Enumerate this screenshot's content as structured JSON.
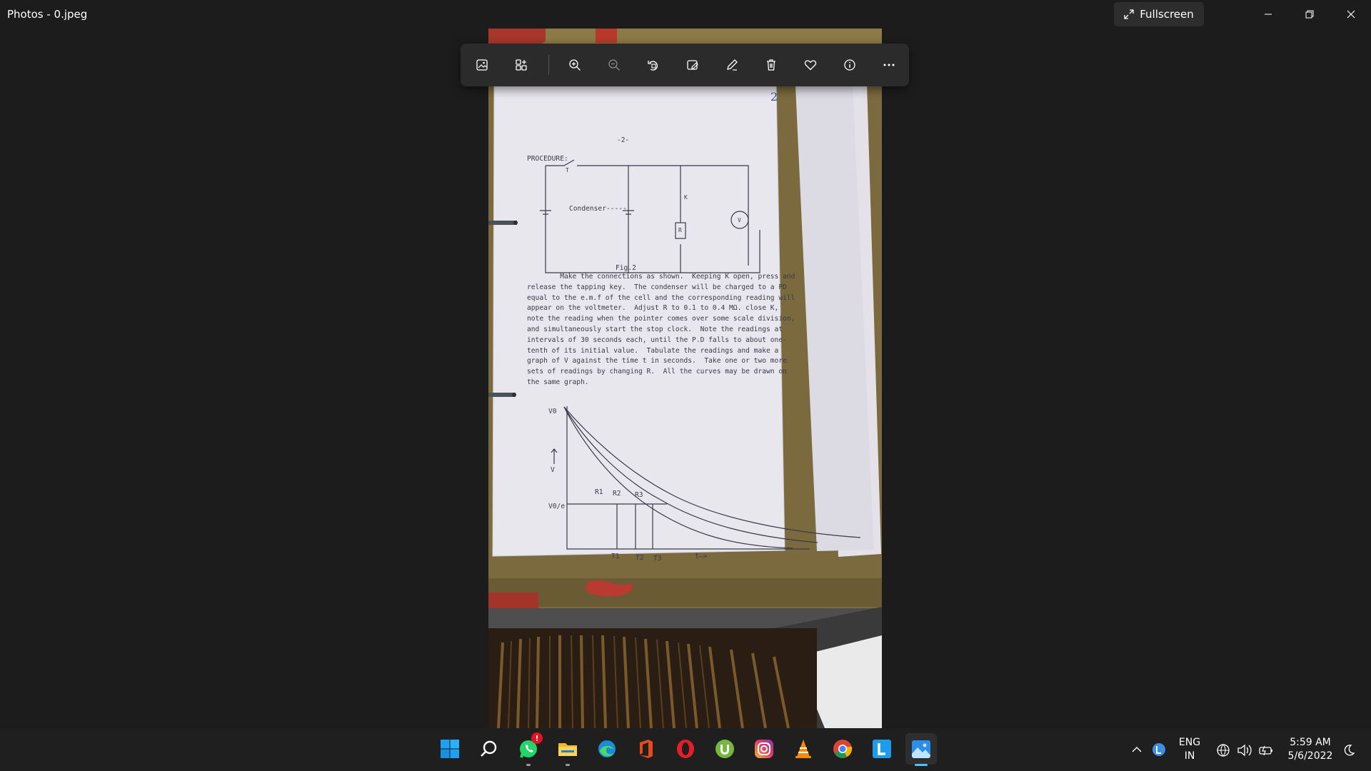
{
  "window": {
    "title": "Photos - 0.jpeg",
    "fullscreen_label": "Fullscreen",
    "minimize_icon": "minimize-icon",
    "restore_icon": "restore-icon",
    "close_icon": "close-icon"
  },
  "toolbar": {
    "buttons": [
      {
        "name": "view-actual-size-icon"
      },
      {
        "name": "gallery-icon"
      },
      {
        "name": "zoom-in-icon"
      },
      {
        "name": "zoom-out-icon"
      },
      {
        "name": "rotate-icon"
      },
      {
        "name": "edit-image-icon"
      },
      {
        "name": "draw-icon"
      },
      {
        "name": "delete-icon"
      },
      {
        "name": "favorite-icon"
      },
      {
        "name": "info-icon"
      },
      {
        "name": "more-icon"
      }
    ]
  },
  "photo": {
    "page_number_mark": "2",
    "page_top_mark": "-2-",
    "heading": "PROCEDURE:",
    "fig_caption": "Fig.2",
    "condenser_label": "Condenser-----",
    "circuit_labels": {
      "switch": "T",
      "key": "K",
      "resistor": "R",
      "voltmeter": "V"
    },
    "procedure_lines": [
      "        Make the connections as shown.  Keeping K open, press and",
      "release the tapping key.  The condenser will be charged to a PD",
      "equal to the e.m.f of the cell and the corresponding reading will",
      "appear on the voltmeter.  Adjust R to 0.1 to 0.4 MΩ. close K,",
      "note the reading when the pointer comes over some scale division,",
      "and simultaneously start the stop clock.  Note the readings at",
      "intervals of 30 seconds each, until the P.D falls to about one-",
      "tenth of its initial value.  Tabulate the readings and make a",
      "graph of V against the time t in seconds.  Take one or two more",
      "sets of readings by changing R.  All the curves may be drawn on",
      "the same graph."
    ],
    "graph_labels": {
      "v0": "V0",
      "v_axis": "V",
      "v0e": "V0/e",
      "r1": "R1",
      "r2": "R2",
      "r3": "R3",
      "t1": "T1",
      "t2": "T2",
      "t3": "T3",
      "t_axis": "t—>"
    }
  },
  "taskbar": {
    "apps": [
      {
        "name": "start-icon"
      },
      {
        "name": "search-icon"
      },
      {
        "name": "whatsapp-icon",
        "badge": "!"
      },
      {
        "name": "file-explorer-icon"
      },
      {
        "name": "edge-icon"
      },
      {
        "name": "office-icon"
      },
      {
        "name": "opera-icon"
      },
      {
        "name": "utorrent-icon"
      },
      {
        "name": "instagram-icon"
      },
      {
        "name": "vlc-icon"
      },
      {
        "name": "chrome-icon"
      },
      {
        "name": "l-app-icon"
      },
      {
        "name": "photos-icon"
      }
    ],
    "tray": {
      "lang_top": "ENG",
      "lang_bottom": "IN",
      "time": "5:59 AM",
      "date": "5/6/2022"
    }
  },
  "colors": {
    "background": "#1c1c1c",
    "toolbar": "#2b2b2b",
    "taskbar": "#1f1f1f",
    "accent": "#4cc2ff"
  }
}
